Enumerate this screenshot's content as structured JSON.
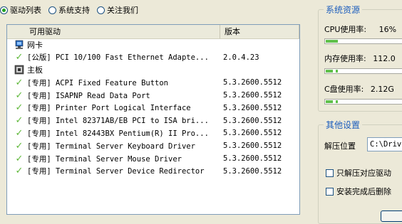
{
  "tabs": [
    {
      "label": "驱动列表",
      "selected": true
    },
    {
      "label": "系统支持",
      "selected": false
    },
    {
      "label": "关注我们",
      "selected": false
    }
  ],
  "driver_list": {
    "columns": [
      "可用驱动",
      "版本"
    ],
    "rows": [
      {
        "type": "group",
        "icon": "network-card-icon",
        "name": "网卡",
        "version": ""
      },
      {
        "type": "item",
        "icon": "check-icon",
        "name": "[公版] PCI 10/100 Fast Ethernet Adapte...",
        "version": "2.0.4.23"
      },
      {
        "type": "group",
        "icon": "motherboard-icon",
        "name": "主板",
        "version": ""
      },
      {
        "type": "item",
        "icon": "check-icon",
        "name": "[专用] ACPI Fixed Feature Button",
        "version": "5.3.2600.5512"
      },
      {
        "type": "item",
        "icon": "check-icon",
        "name": "[专用] ISAPNP Read Data Port",
        "version": "5.3.2600.5512"
      },
      {
        "type": "item",
        "icon": "check-icon",
        "name": "[专用] Printer Port Logical Interface",
        "version": "5.3.2600.5512"
      },
      {
        "type": "item",
        "icon": "check-icon",
        "name": "[专用] Intel 82371AB/EB PCI to ISA bri...",
        "version": "5.3.2600.5512"
      },
      {
        "type": "item",
        "icon": "check-icon",
        "name": "[专用] Intel 82443BX Pentium(R) II Pro...",
        "version": "5.3.2600.5512"
      },
      {
        "type": "item",
        "icon": "check-icon",
        "name": "[专用] Terminal Server Keyboard Driver",
        "version": "5.3.2600.5512"
      },
      {
        "type": "item",
        "icon": "check-icon",
        "name": "[专用] Terminal Server Mouse Driver",
        "version": "5.3.2600.5512"
      },
      {
        "type": "item",
        "icon": "check-icon",
        "name": "[专用] Terminal Server Device Redirector",
        "version": "5.3.2600.5512"
      }
    ]
  },
  "system_resources": {
    "title": "系统资源",
    "cpu": {
      "label": "CPU使用率:",
      "value": "16%",
      "fraction": 0.16
    },
    "memory": {
      "label": "内存使用率:",
      "value": "112.0"
    },
    "disk": {
      "label": "C盘使用率:",
      "value": "2.12G"
    }
  },
  "other_settings": {
    "title": "其他设置",
    "extract_label": "解压位置",
    "extract_path": "C:\\Drive",
    "checkbox_extract_only": "只解压对应驱动",
    "checkbox_delete_after": "安装完成后删除"
  },
  "colors": {
    "accent_title": "#1d5ebd",
    "bar_fill": "#5fbf4a",
    "check_green": "#5fb83a"
  }
}
